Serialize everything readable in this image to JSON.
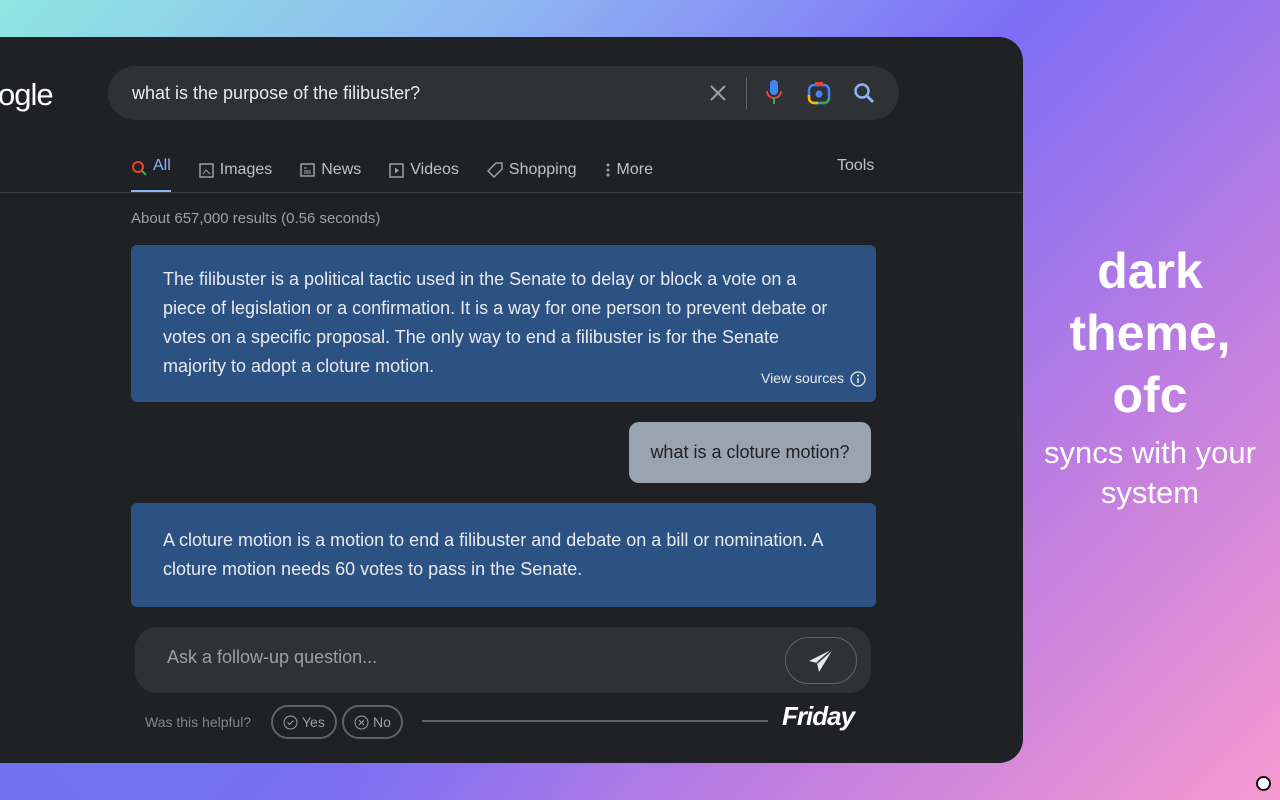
{
  "logo": "ogle",
  "search": {
    "query": "what is the purpose of the filibuster?"
  },
  "tabs": [
    {
      "label": "All",
      "icon": "search-icon"
    },
    {
      "label": "Images",
      "icon": "image-icon"
    },
    {
      "label": "News",
      "icon": "news-icon"
    },
    {
      "label": "Videos",
      "icon": "play-icon"
    },
    {
      "label": "Shopping",
      "icon": "tag-icon"
    },
    {
      "label": "More",
      "icon": "dots-vertical-icon"
    }
  ],
  "tools": "Tools",
  "stats": "About 657,000 results (0.56 seconds)",
  "chat": {
    "answer1": "The filibuster is a political tactic used in the Senate to delay or block a vote on a piece of legislation or a confirmation. It is a way for one person to prevent debate or votes on a specific proposal. The only way to end a filibuster is for the Senate majority to adopt a cloture motion.",
    "view_sources": "View sources",
    "user_question": "what is a cloture motion?",
    "answer2": "A cloture motion is a motion to end a filibuster and debate on a bill or nomination. A cloture motion needs 60 votes to pass in the Senate.",
    "placeholder": "Ask a follow-up question...",
    "helpful": "Was this helpful?",
    "yes": "Yes",
    "no": "No",
    "brand": "Friday"
  },
  "promo": {
    "headline": "dark theme, ofc",
    "sub": "syncs with your system"
  },
  "colors": {
    "answer_bg": "#2c5284",
    "accent": "#8ab4f8",
    "window_bg": "#202124"
  }
}
